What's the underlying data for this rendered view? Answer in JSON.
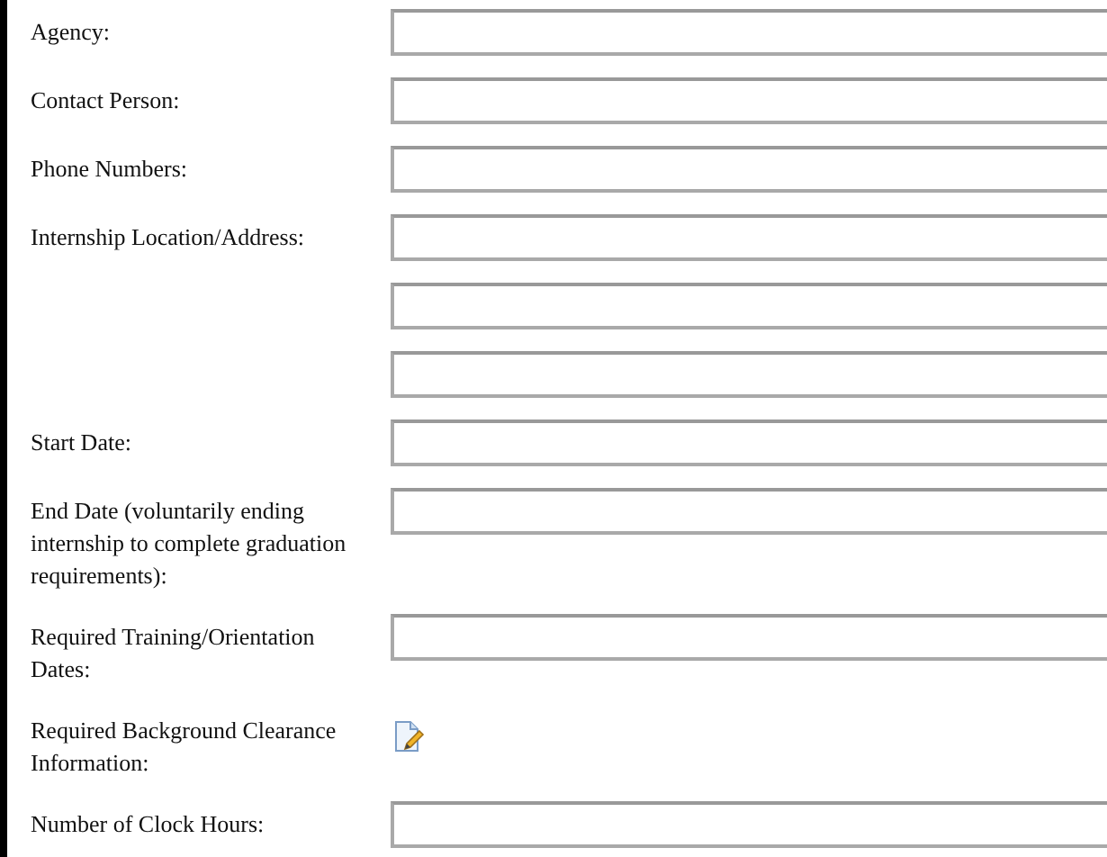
{
  "form_rows": [
    {
      "kind": "input",
      "label": "Agency:"
    },
    {
      "kind": "input",
      "label": "Contact Person:"
    },
    {
      "kind": "input",
      "label": "Phone Numbers:"
    },
    {
      "kind": "input",
      "label": "Internship Location/Address:"
    },
    {
      "kind": "continuation"
    },
    {
      "kind": "continuation"
    },
    {
      "kind": "input",
      "label": "Start Date:"
    },
    {
      "kind": "input",
      "label": "End Date (voluntarily ending internship to complete graduation requirements):"
    },
    {
      "kind": "input",
      "label": "Required Training/Orientation Dates:"
    },
    {
      "kind": "edit-icon",
      "label": "Required Background Clearance Information:"
    },
    {
      "kind": "input",
      "label": "Number of Clock Hours:"
    }
  ]
}
